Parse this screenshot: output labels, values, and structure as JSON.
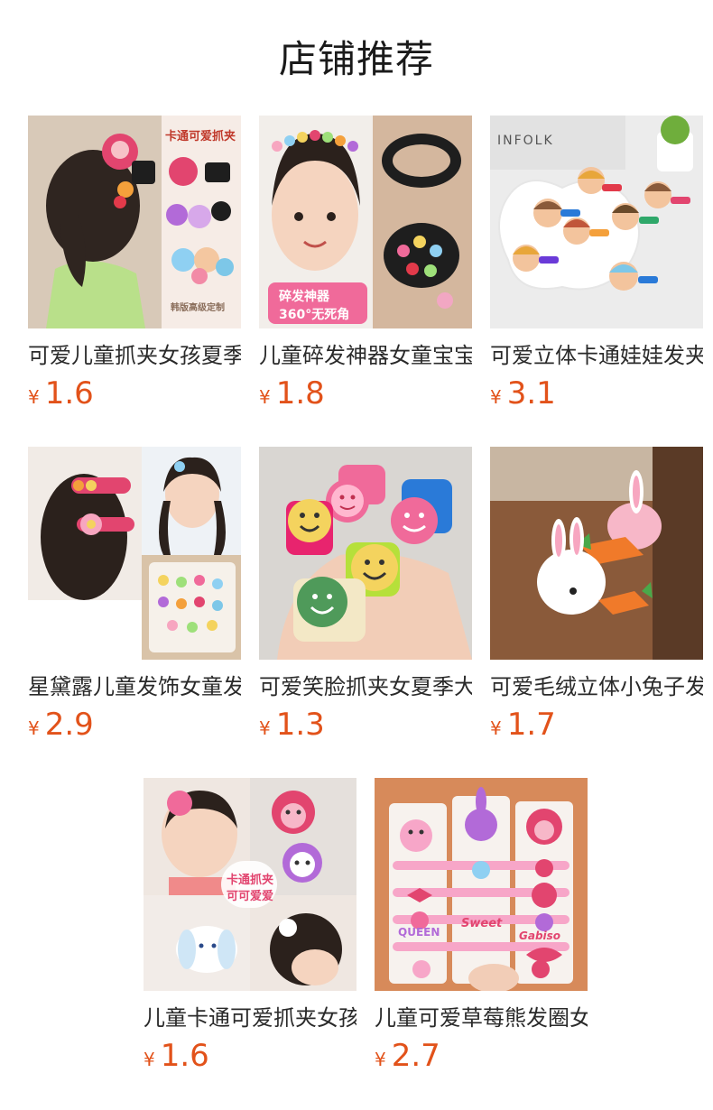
{
  "page": {
    "title": "店铺推荐"
  },
  "products": [
    {
      "title": "可爱儿童抓夹女孩夏季",
      "currency": "¥",
      "price": "1.6",
      "image_text": [
        "卡通可爱抓夹",
        "韩版高级定制"
      ]
    },
    {
      "title": "儿童碎发神器女童宝宝",
      "currency": "¥",
      "price": "1.8",
      "image_text": [
        "碎发神器",
        "360°无死角"
      ]
    },
    {
      "title": "可爱立体卡通娃娃发夹",
      "currency": "¥",
      "price": "3.1",
      "image_text": [
        "INFOLK"
      ]
    },
    {
      "title": "星黛露儿童发饰女童发",
      "currency": "¥",
      "price": "2.9",
      "image_text": []
    },
    {
      "title": "可爱笑脸抓夹女夏季大",
      "currency": "¥",
      "price": "1.3",
      "image_text": []
    },
    {
      "title": "可爱毛绒立体小兔子发",
      "currency": "¥",
      "price": "1.7",
      "image_text": []
    },
    {
      "title": "儿童卡通可爱抓夹女孩",
      "currency": "¥",
      "price": "1.6",
      "image_text": [
        "卡通抓夹",
        "可可爱爱"
      ]
    },
    {
      "title": "儿童可爱草莓熊发圈女",
      "currency": "¥",
      "price": "2.7",
      "image_text": [
        "QUEEN",
        "Sweet",
        "Gabiso"
      ]
    }
  ],
  "colors": {
    "price": "#e2521a",
    "title": "#1a1a1a",
    "background": "#ffffff"
  }
}
